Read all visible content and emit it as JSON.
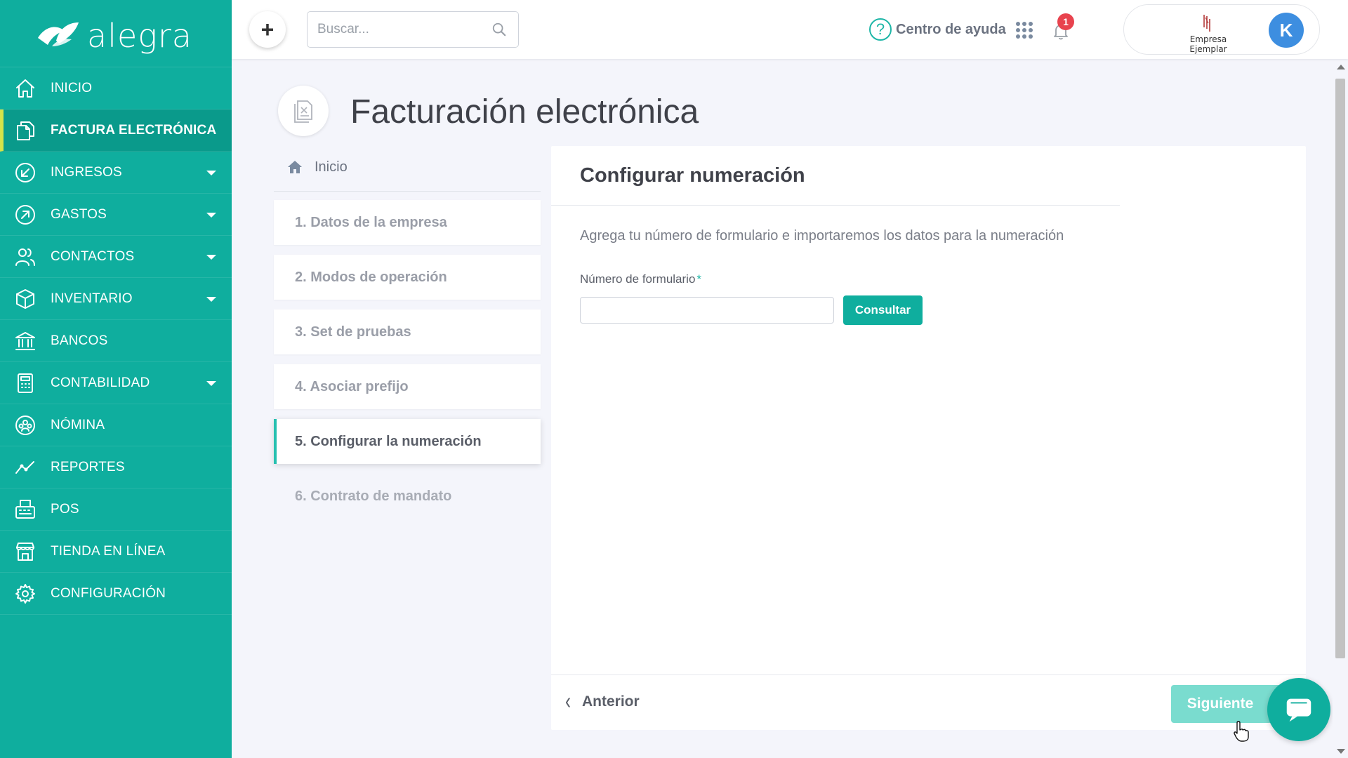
{
  "brand": {
    "name": "alegra",
    "accent": "#0fae9e",
    "active_marker": "#d3e34a"
  },
  "sidebar": {
    "items": [
      {
        "label": "INICIO",
        "icon": "home-icon",
        "caret": false,
        "active": false
      },
      {
        "label": "FACTURA ELECTRÓNICA",
        "icon": "documents-icon",
        "caret": false,
        "active": true
      },
      {
        "label": "INGRESOS",
        "icon": "arrow-in-icon",
        "caret": true,
        "active": false
      },
      {
        "label": "GASTOS",
        "icon": "arrow-out-icon",
        "caret": true,
        "active": false
      },
      {
        "label": "CONTACTOS",
        "icon": "users-icon",
        "caret": true,
        "active": false
      },
      {
        "label": "INVENTARIO",
        "icon": "box-icon",
        "caret": true,
        "active": false
      },
      {
        "label": "BANCOS",
        "icon": "bank-icon",
        "caret": false,
        "active": false
      },
      {
        "label": "CONTABILIDAD",
        "icon": "calculator-icon",
        "caret": true,
        "active": false
      },
      {
        "label": "NÓMINA",
        "icon": "payroll-icon",
        "caret": false,
        "active": false
      },
      {
        "label": "REPORTES",
        "icon": "trend-icon",
        "caret": false,
        "active": false
      },
      {
        "label": "POS",
        "icon": "register-icon",
        "caret": false,
        "active": false
      },
      {
        "label": "TIENDA EN LÍNEA",
        "icon": "store-icon",
        "caret": false,
        "active": false
      },
      {
        "label": "CONFIGURACIÓN",
        "icon": "gear-icon",
        "caret": false,
        "active": false
      }
    ]
  },
  "topbar": {
    "add_label": "+",
    "search": {
      "placeholder": "Buscar...",
      "value": ""
    },
    "help_symbol": "?",
    "help_label": "Centro de ayuda",
    "notifications_count": "1",
    "company_name": "Empresa Ejemplar",
    "avatar_initial": "K",
    "avatar_color": "#3d8ee0",
    "badge_color": "#e8434e"
  },
  "page": {
    "title": "Facturación electrónica"
  },
  "steps": {
    "home_label": "Inicio",
    "items": [
      {
        "label": "1. Datos de la empresa",
        "state": "done"
      },
      {
        "label": "2. Modos de operación",
        "state": "done"
      },
      {
        "label": "3. Set de pruebas",
        "state": "done"
      },
      {
        "label": "4. Asociar prefijo",
        "state": "done"
      },
      {
        "label": "5. Configurar la numeración",
        "state": "active"
      },
      {
        "label": "6. Contrato de mandato",
        "state": "pending"
      }
    ]
  },
  "form": {
    "title": "Configurar numeración",
    "description": "Agrega tu número de formulario e importaremos los datos para la numeración",
    "field_label": "Número de formulario",
    "required_mark": "*",
    "field_value": "",
    "consult_label": "Consultar",
    "prev_label": "Anterior",
    "next_label": "Siguiente"
  }
}
